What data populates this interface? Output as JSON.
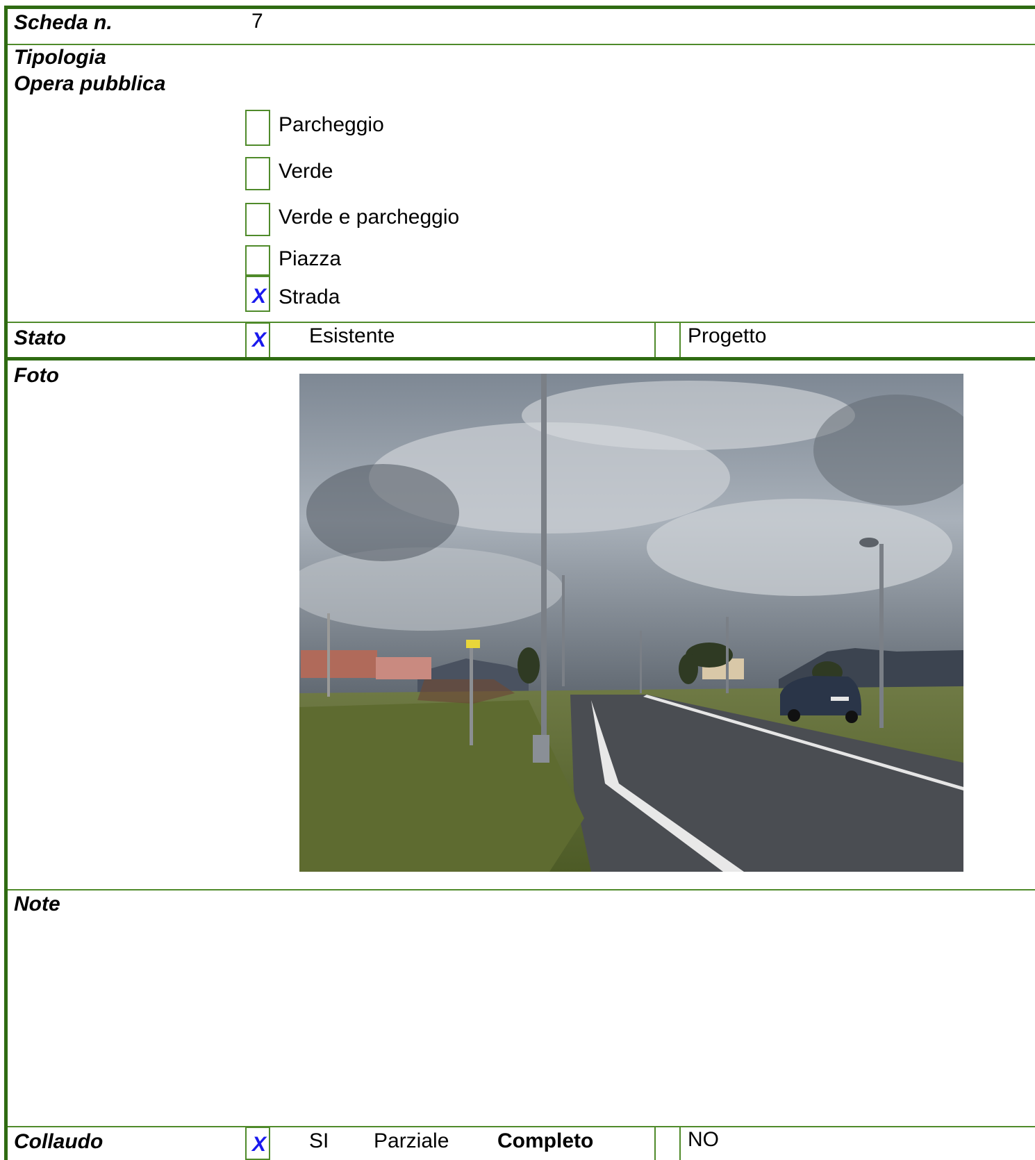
{
  "scheda": {
    "label": "Scheda n.",
    "value": "7"
  },
  "tipologia": {
    "label_line1": "Tipologia",
    "label_line2": "Opera pubblica",
    "options": [
      {
        "label": "Parcheggio",
        "checked": false,
        "mark": ""
      },
      {
        "label": "Verde",
        "checked": false,
        "mark": ""
      },
      {
        "label": "Verde e parcheggio",
        "checked": false,
        "mark": ""
      },
      {
        "label": "Piazza",
        "checked": false,
        "mark": ""
      },
      {
        "label": "Strada",
        "checked": true,
        "mark": "X"
      }
    ]
  },
  "stato": {
    "label": "Stato",
    "esistente": {
      "label": "Esistente",
      "mark": "X"
    },
    "progetto": {
      "label": "Progetto",
      "mark": ""
    }
  },
  "foto": {
    "label": "Foto"
  },
  "note": {
    "label": "Note"
  },
  "collaudo": {
    "label": "Collaudo",
    "si": {
      "label": "SI",
      "mark": "X"
    },
    "parziale": "Parziale",
    "completo": "Completo",
    "no": {
      "label": "NO",
      "mark": ""
    }
  },
  "colors": {
    "border": "#4f8a2a",
    "border_thick": "#2f6b12",
    "mark": "#1a1aee"
  }
}
